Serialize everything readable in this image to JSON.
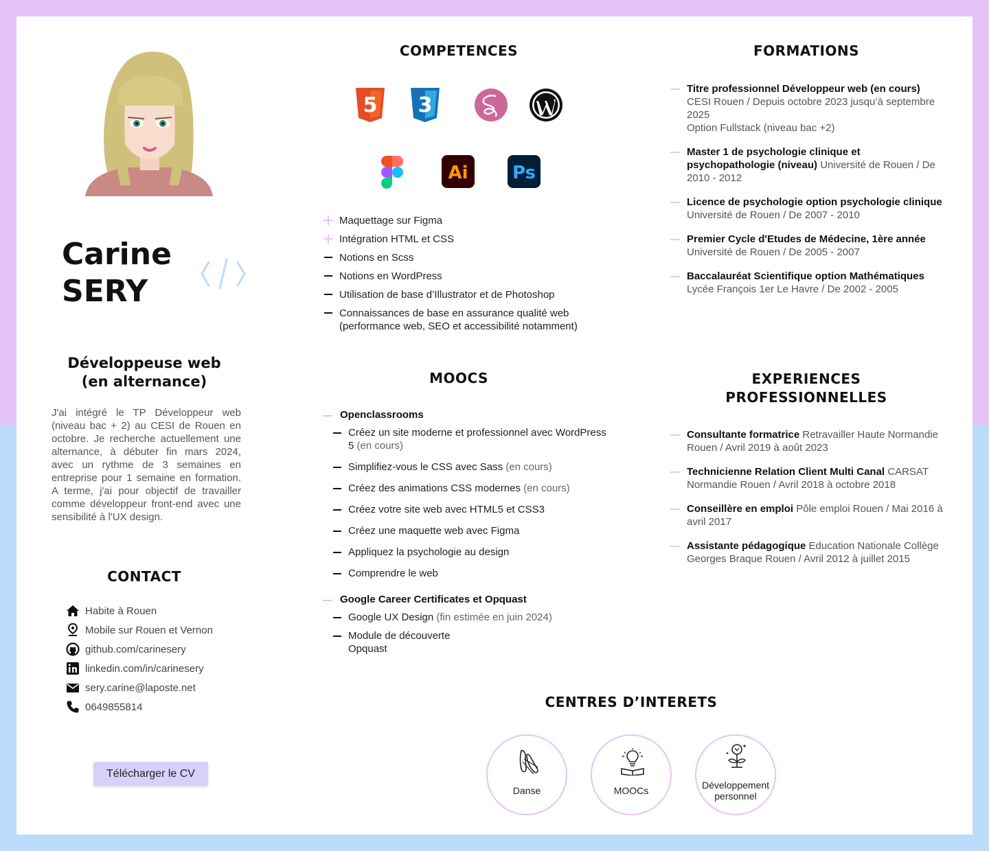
{
  "profile": {
    "first_name": "Carine",
    "last_name": "SERY",
    "job_line1": "Développeuse web",
    "job_line2": "(en alternance)",
    "intro": "J'ai intégré le TP Développeur web (niveau bac + 2) au CESI de Rouen en octobre. Je recherche actuellement une alternance, à débuter fin mars 2024, avec un rythme de 3 semaines en entreprise pour 1 semaine en formation. A terme, j'ai pour objectif de travailler comme développeur front-end avec une sensibilité à l'UX design."
  },
  "contact": {
    "title": "CONTACT",
    "items": [
      {
        "icon": "home-icon",
        "text": "Habite à Rouen"
      },
      {
        "icon": "location-pin-icon",
        "text": "Mobile sur Rouen et Vernon"
      },
      {
        "icon": "github-icon",
        "text": "github.com/carinesery"
      },
      {
        "icon": "linkedin-icon",
        "text": "linkedin.com/in/carinesery"
      },
      {
        "icon": "mail-icon",
        "text": "sery.carine@laposte.net"
      },
      {
        "icon": "phone-icon",
        "text": "0649855814"
      }
    ],
    "download_label": "Télécharger le CV"
  },
  "competences": {
    "title": "COMPETENCES",
    "logos": {
      "html5": "5",
      "css3": "3",
      "illustrator": "Ai",
      "photoshop": "Ps"
    },
    "skills": [
      {
        "mark": "plus",
        "text": "Maquettage sur Figma"
      },
      {
        "mark": "plus",
        "text": "Intégration HTML et CSS"
      },
      {
        "mark": "dash",
        "text": "Notions en Scss"
      },
      {
        "mark": "dash",
        "text": "Notions en WordPress"
      },
      {
        "mark": "dash",
        "text": "Utilisation de base d’Illustrator et de Photoshop"
      },
      {
        "mark": "dash",
        "text": "Connaissances de base en assurance qualité web (performance web, SEO et accessibilité notamment)"
      }
    ]
  },
  "moocs": {
    "title": "MOOCS",
    "groups": [
      {
        "title": "Openclassrooms",
        "items": [
          {
            "text": "Créez un site moderne et professionnel avec WordPress 5",
            "note": "(en cours)"
          },
          {
            "text": "Simplifiez-vous le CSS avec Sass",
            "note": "(en cours)"
          },
          {
            "text": "Créez des animations CSS modernes",
            "note": "(en cours)"
          },
          {
            "text": "Créez votre site web avec HTML5 et CSS3",
            "note": ""
          },
          {
            "text": "Créez une maquette web avec Figma",
            "note": ""
          },
          {
            "text": "Appliquez la psychologie au design",
            "note": ""
          },
          {
            "text": "Comprendre le web",
            "note": ""
          }
        ]
      },
      {
        "title": "Google Career Certificates et Opquast",
        "items": [
          {
            "text": "Google UX Design",
            "note": "(fin estimée en juin 2024)"
          },
          {
            "text": "Module de découverte Opquast",
            "note": ""
          }
        ]
      }
    ]
  },
  "formations": {
    "title": "FORMATIONS",
    "items": [
      {
        "bold": "Titre professionnel Développeur web (en cours)",
        "rest": "CESI Rouen / Depuis octobre 2023 jusqu’à septembre 2025",
        "rest2": "Option Fullstack (niveau bac +2)"
      },
      {
        "bold": "Master 1 de psychologie clinique et psychopathologie (niveau)",
        "rest": "Université de Rouen / De 2010 - 2012",
        "rest2": ""
      },
      {
        "bold": "Licence de psychologie option psychologie clinique",
        "rest": "Université de Rouen / De 2007 - 2010",
        "rest2": ""
      },
      {
        "bold": "Premier Cycle d'Etudes de Médecine, 1ère année",
        "rest": "Université de Rouen / De 2005 - 2007",
        "rest2": ""
      },
      {
        "bold": "Baccalauréat Scientifique option Mathématiques",
        "rest": "Lycée François 1er Le Havre / De 2002 - 2005",
        "rest2": ""
      }
    ]
  },
  "experiences": {
    "title_line1": "EXPERIENCES",
    "title_line2": "PROFESSIONNELLES",
    "items": [
      {
        "bold": "Consultante formatrice",
        "rest": "Retravailler Haute Normandie Rouen / Avril 2019 à août 2023"
      },
      {
        "bold": "Technicienne Relation Client Multi Canal",
        "rest": "CARSAT Normandie Rouen / Avril 2018 à octobre 2018"
      },
      {
        "bold": "Conseillère en emploi",
        "rest": "Pôle emploi Rouen / Mai 2016 à avril 2017"
      },
      {
        "bold": "Assistante pédagogique",
        "rest": "Education Nationale Collège Georges Braque Rouen / Avril 2012 à juillet 2015"
      }
    ]
  },
  "interests": {
    "title": "CENTRES D’INTERETS",
    "items": [
      {
        "icon": "ballet-shoes-icon",
        "label": "Danse"
      },
      {
        "icon": "lightbulb-book-icon",
        "label": "MOOCs"
      },
      {
        "icon": "growing-plant-icon",
        "label": "Développement personnel"
      }
    ]
  },
  "colors": {
    "lavender": "#e6c3f7",
    "light_blue": "#bcdcfb",
    "button": "#d8d0fb",
    "html5": "#e44d26",
    "css3": "#2a8bd8",
    "sass": "#cd6799",
    "illustrator_bg": "#330000",
    "illustrator_fg": "#ff9a00",
    "photoshop_bg": "#001e36",
    "photoshop_fg": "#31a8ff"
  }
}
